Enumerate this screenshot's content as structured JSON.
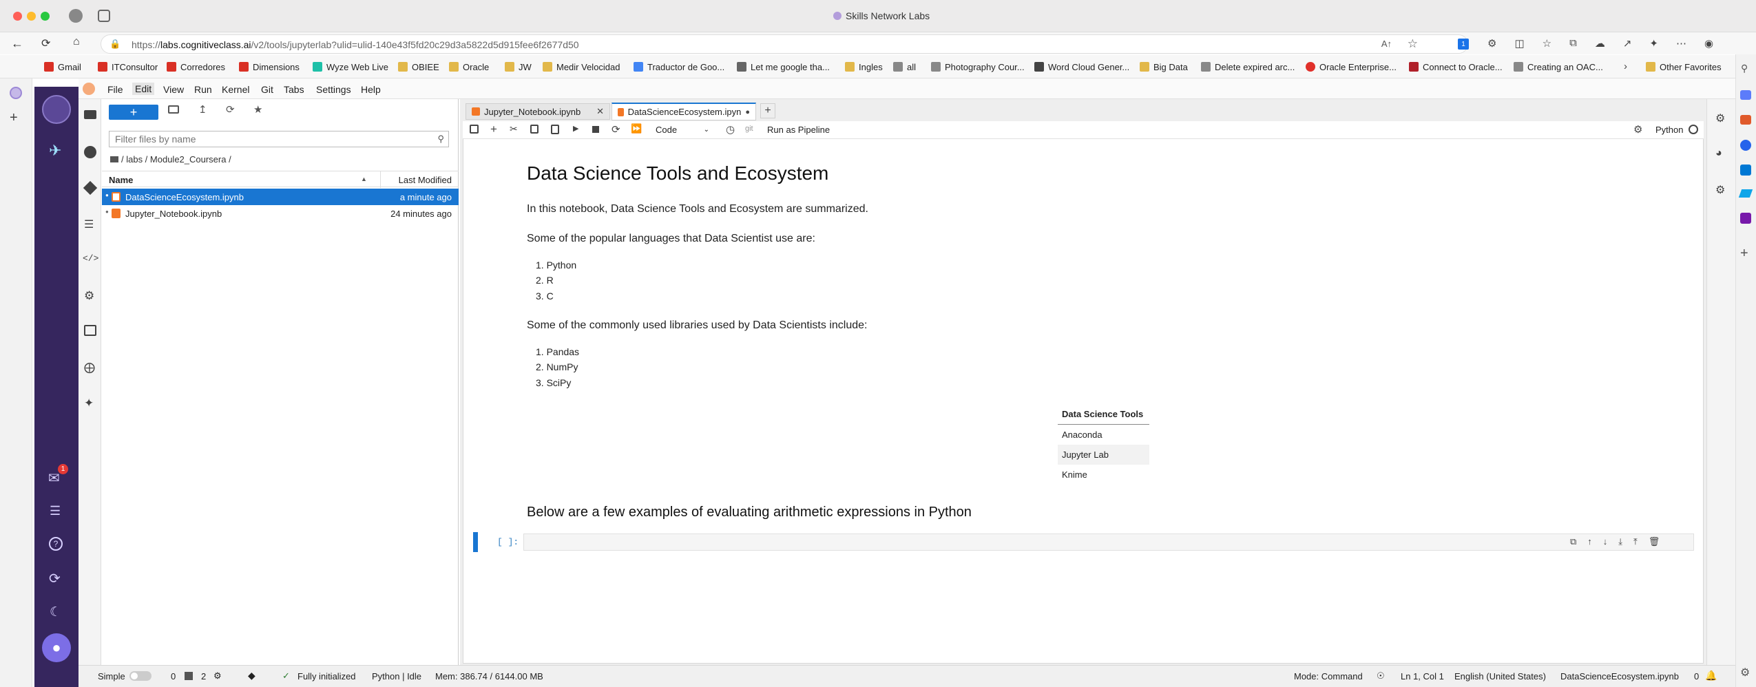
{
  "window": {
    "title": "Skills Network Labs"
  },
  "browser": {
    "url_prefix": "https://",
    "url_domain": "labs.cognitiveclass.ai",
    "url_path": "/v2/tools/jupyterlab?ulid=ulid-140e43f5fd20c29d3a5822d5d915fee6f2677d50",
    "favorites": [
      {
        "label": "Gmail",
        "color": "#d93025"
      },
      {
        "label": "ITConsultor",
        "color": "#d93025"
      },
      {
        "label": "Corredores",
        "color": "#d93025"
      },
      {
        "label": "Dimensions",
        "color": "#d93025"
      },
      {
        "label": "Wyze Web Live",
        "color": "#1ec0a8"
      },
      {
        "label": "OBIEE",
        "color": "#e2b84a"
      },
      {
        "label": "Oracle",
        "color": "#e2b84a"
      },
      {
        "label": "JW",
        "color": "#e2b84a"
      },
      {
        "label": "Medir Velocidad",
        "color": "#e2b84a"
      },
      {
        "label": "Traductor de Goo...",
        "color": "#4285f4"
      },
      {
        "label": "Let me google tha...",
        "color": "#666666"
      },
      {
        "label": "Ingles",
        "color": "#e2b84a"
      },
      {
        "label": "all",
        "color": "#888888"
      },
      {
        "label": "Photography Cour...",
        "color": "#888888"
      },
      {
        "label": "Word Cloud Gener...",
        "color": "#444444"
      },
      {
        "label": "Big Data",
        "color": "#e2b84a"
      },
      {
        "label": "Delete expired arc...",
        "color": "#888888"
      },
      {
        "label": "Oracle Enterprise...",
        "color": "#e0302a"
      },
      {
        "label": "Connect to Oracle...",
        "color": "#b0202a"
      },
      {
        "label": "Creating an OAC...",
        "color": "#888888"
      }
    ],
    "other_favorites": "Other Favorites"
  },
  "menu": [
    "File",
    "Edit",
    "View",
    "Run",
    "Kernel",
    "Git",
    "Tabs",
    "Settings",
    "Help"
  ],
  "filebrowser": {
    "new_button": "+",
    "filter_placeholder": "Filter files by name",
    "breadcrumb": "/ labs / Module2_Coursera /",
    "col_name": "Name",
    "col_modified": "Last Modified",
    "files": [
      {
        "name": "DataScienceEcosystem.ipynb",
        "modified": "a minute ago",
        "selected": true
      },
      {
        "name": "Jupyter_Notebook.ipynb",
        "modified": "24 minutes ago",
        "selected": false
      }
    ]
  },
  "tabs": [
    {
      "label": "Jupyter_Notebook.ipynb",
      "active": false
    },
    {
      "label": "DataScienceEcosystem.ipyn",
      "active": true
    }
  ],
  "toolbar": {
    "cell_type": "Code",
    "git_label": "git",
    "pipeline": "Run as Pipeline",
    "kernel": "Python"
  },
  "notebook": {
    "title": "Data Science Tools and Ecosystem",
    "intro": "In this notebook, Data Science Tools and Ecosystem are summarized.",
    "languages_intro": "Some of the popular languages that Data Scientist use are:",
    "languages": [
      "1. Python",
      "2. R",
      "3. C"
    ],
    "libraries_intro": "Some of the commonly used libraries used by Data Scientists include:",
    "libraries": [
      "1. Pandas",
      "2. NumPy",
      "3. SciPy"
    ],
    "table_header": "Data Science Tools",
    "table_rows": [
      "Anaconda",
      "Jupyter Lab",
      "Knime"
    ],
    "arith_heading": "Below are a few examples of evaluating arithmetic expressions in Python",
    "prompt": "[ ]:"
  },
  "sidebar": {
    "notification_count": "1"
  },
  "status": {
    "simple": "Simple",
    "terminals": "0",
    "kernels": "2",
    "init": "Fully initialized",
    "kernel_state": "Python | Idle",
    "mem": "Mem: 386.74 / 6144.00 MB",
    "mode": "Mode: Command",
    "pos": "Ln 1, Col 1",
    "lang": "English (United States)",
    "file": "DataScienceEcosystem.ipynb",
    "count": "0"
  },
  "colors": {
    "accent": "#1976d2",
    "sidebar_purple": "#36265e"
  }
}
